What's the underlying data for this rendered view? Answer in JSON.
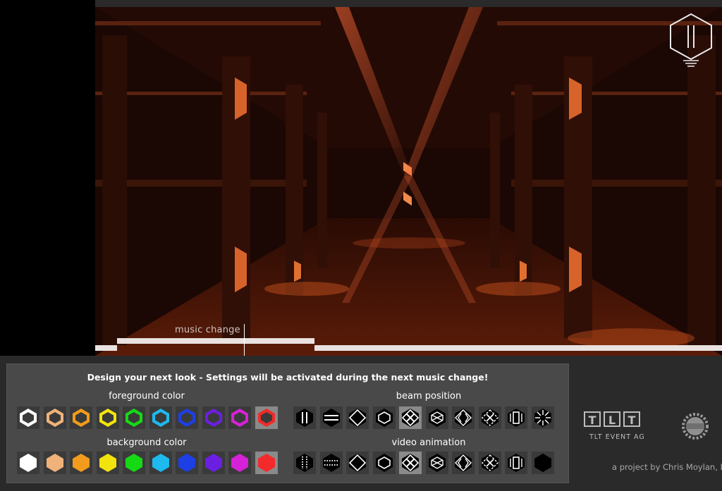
{
  "video": {
    "music_change_label": "music change"
  },
  "panel": {
    "title": "Design your next look - Settings will be activated during the next music change!",
    "foreground_label": "foreground color",
    "background_label": "background color",
    "beam_label": "beam position",
    "video_label": "video animation"
  },
  "foreground_colors": [
    "#ffffff",
    "#f0b27a",
    "#f29b1c",
    "#f2e30d",
    "#16d916",
    "#1eb9ee",
    "#1d3fe6",
    "#6b1fe0",
    "#d622d6",
    "#f22a2a"
  ],
  "background_colors": [
    "#ffffff",
    "#f0b27a",
    "#f29b1c",
    "#f2e30d",
    "#16d916",
    "#1eb9ee",
    "#1d3fe6",
    "#6b1fe0",
    "#d622d6",
    "#f22a2a"
  ],
  "selected": {
    "foreground_index": 9,
    "background_index": 9,
    "beam_index": 4,
    "video_index": 4
  },
  "beam_icons": [
    "vertical-lines-icon",
    "horizontal-lines-icon",
    "diamond-icon",
    "hexagon-outline-icon",
    "x-cross-icon",
    "crossed-diamond-icon",
    "double-chevron-icon",
    "star-cross-icon",
    "bracket-rect-icon",
    "starburst-icon"
  ],
  "video_icons": [
    "dotted-vertical-icon",
    "dotted-horizontal-icon",
    "diamond-icon",
    "hexagon-outline-icon",
    "x-cross-icon",
    "crossed-diamond-icon",
    "double-chevron-icon",
    "star-cross-icon",
    "bracket-rect-icon",
    "solid-hexagon-icon"
  ],
  "sponsor": {
    "tlt_letters": [
      "T",
      "L",
      "T"
    ],
    "tlt_sub": "TLT EVENT AG"
  },
  "credit": "a project by Chris Moylan, L"
}
